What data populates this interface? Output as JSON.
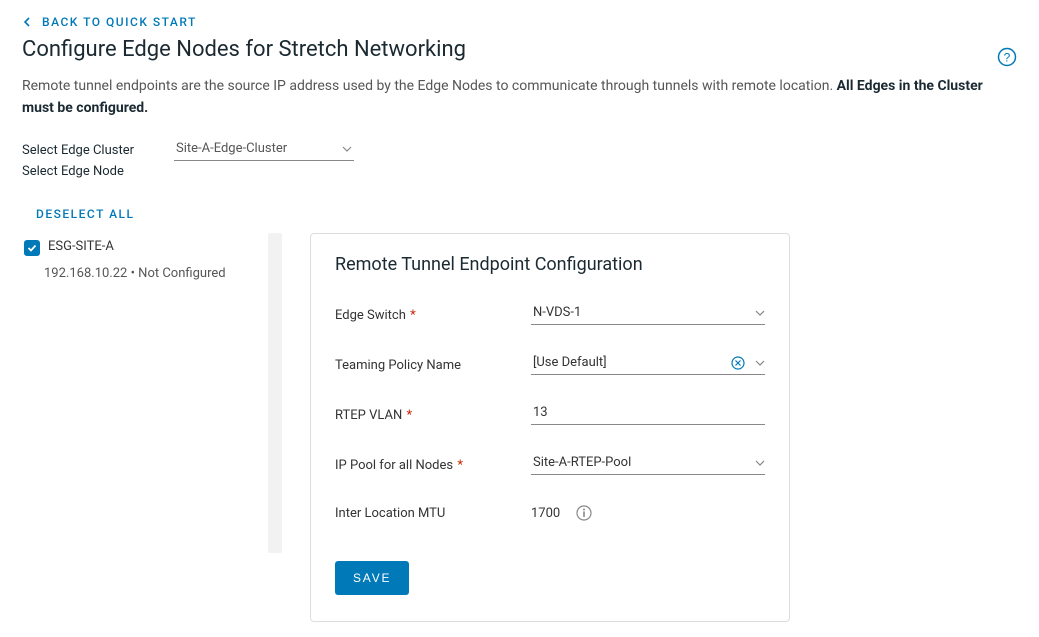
{
  "header": {
    "back_label": "BACK TO QUICK START",
    "title": "Configure Edge Nodes for Stretch Networking",
    "description_pre": "Remote tunnel endpoints are the source IP address used by the Edge Nodes to communicate through tunnels with remote location. ",
    "description_bold": "All Edges in the Cluster must be configured."
  },
  "cluster_selector": {
    "label": "Select Edge Cluster",
    "value": "Site-A-Edge-Cluster",
    "sub_label": "Select Edge Node",
    "deselect_label": "DESELECT ALL"
  },
  "nodes": [
    {
      "name": "ESG-SITE-A",
      "meta": "192.168.10.22 • Not Configured",
      "checked": true
    }
  ],
  "panel": {
    "title": "Remote Tunnel Endpoint Configuration",
    "fields": {
      "edge_switch": {
        "label": "Edge Switch",
        "value": "N-VDS-1",
        "required": true
      },
      "teaming_policy": {
        "label": "Teaming Policy Name",
        "value": "[Use Default]",
        "required": false
      },
      "rtep_vlan": {
        "label": "RTEP VLAN",
        "value": "13",
        "required": true
      },
      "ip_pool": {
        "label": "IP Pool for all Nodes",
        "value": "Site-A-RTEP-Pool",
        "required": true
      },
      "mtu": {
        "label": "Inter Location MTU",
        "value": "1700",
        "required": false
      }
    },
    "save_label": "SAVE"
  }
}
